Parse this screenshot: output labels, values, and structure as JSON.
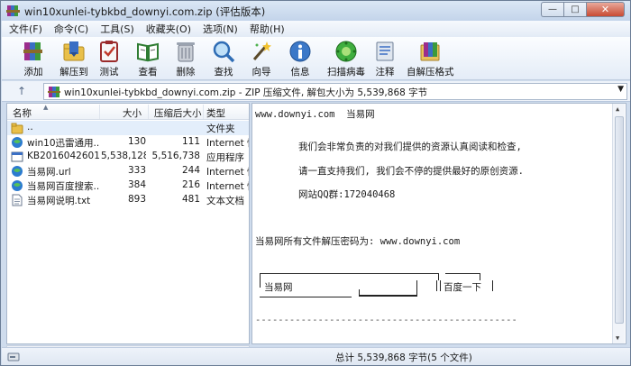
{
  "window": {
    "title": "win10xunlei-tybkbd_downyi.com.zip (评估版本)",
    "controls": {
      "minimize": "—",
      "maximize": "□",
      "close": "✕"
    }
  },
  "menu": [
    "文件(F)",
    "命令(C)",
    "工具(S)",
    "收藏夹(O)",
    "选项(N)",
    "帮助(H)"
  ],
  "toolbar": [
    {
      "label": "添加",
      "icon": "add-books-icon"
    },
    {
      "label": "解压到",
      "icon": "extract-folder-icon"
    },
    {
      "label": "测试",
      "icon": "test-clipboard-icon"
    },
    {
      "label": "查看",
      "icon": "view-book-icon"
    },
    {
      "label": "删除",
      "icon": "trash-icon"
    },
    {
      "label": "查找",
      "icon": "magnifier-icon"
    },
    {
      "label": "向导",
      "icon": "wizard-wand-icon"
    },
    {
      "label": "信息",
      "icon": "info-icon"
    },
    {
      "label": "扫描病毒",
      "icon": "virus-scan-icon"
    },
    {
      "label": "注释",
      "icon": "comment-icon"
    },
    {
      "label": "自解压格式",
      "icon": "sfx-icon"
    }
  ],
  "address": {
    "up_arrow": "↑",
    "text": "win10xunlei-tybkbd_downyi.com.zip - ZIP 压缩文件, 解包大小为 5,539,868 字节"
  },
  "file_list": {
    "columns": {
      "name": "名称",
      "size": "大小",
      "packed": "压缩后大小",
      "type": "类型"
    },
    "rows": [
      {
        "name": "..",
        "size": "",
        "packed": "",
        "type": "文件夹",
        "icon": "folder-up-icon"
      },
      {
        "name": "win10迅雷通用...",
        "size": "130",
        "packed": "111",
        "type": "Internet 快",
        "icon": "ie-globe-icon"
      },
      {
        "name": "KB2016042601...",
        "size": "5,538,128",
        "packed": "5,516,738",
        "type": "应用程序",
        "icon": "exe-icon"
      },
      {
        "name": "当易网.url",
        "size": "333",
        "packed": "244",
        "type": "Internet 快",
        "icon": "ie-globe-icon"
      },
      {
        "name": "当易网百度搜索...",
        "size": "384",
        "packed": "216",
        "type": "Internet 快",
        "icon": "ie-globe-icon"
      },
      {
        "name": "当易网说明.txt",
        "size": "893",
        "packed": "481",
        "type": "文本文档",
        "icon": "text-file-icon"
      }
    ]
  },
  "comment": {
    "line1": "www.downyi.com  当易网",
    "line2": "我们会非常负责的对我们提供的资源认真阅读和检查,",
    "line3": "请一直支持我们, 我们会不停的提供最好的原创资源.",
    "line4": "网站QQ群:172040468",
    "line5": "当易网所有文件解压密码为: www.downyi.com",
    "box_label1": "当易网",
    "box_label2": "百度一下",
    "dash_line": "----------------------------------------------"
  },
  "status": {
    "text": "总计 5,539,868 字节(5 个文件)"
  },
  "colors": {
    "frame": "#cfdced",
    "selection": "#e3eefb",
    "close_button": "#c84a33"
  }
}
